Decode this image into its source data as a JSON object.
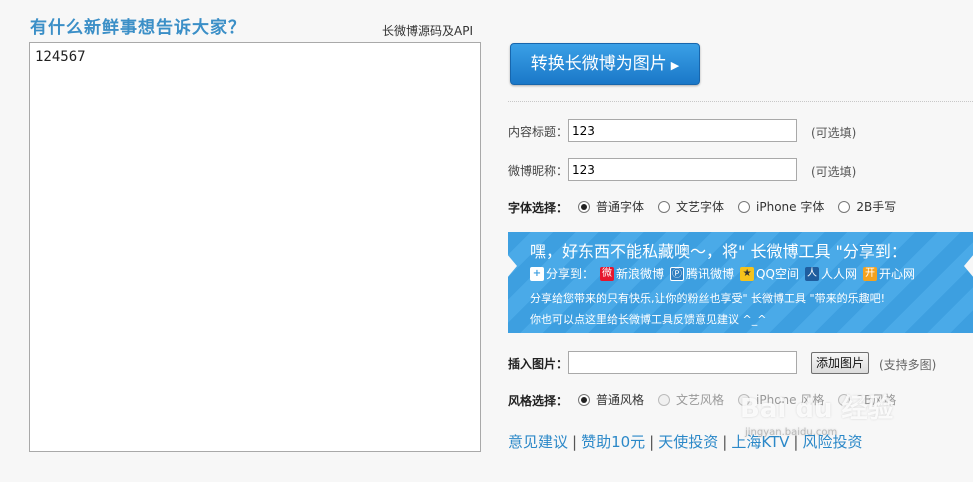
{
  "left": {
    "prompt": "有什么新鲜事想告诉大家？",
    "api_link": "长微博源码及API",
    "textarea_value": "124567"
  },
  "right": {
    "convert_button": "转换长微博为图片",
    "title_label": "内容标题：",
    "title_value": "123",
    "title_optional": "(可选填)",
    "nick_label": "微博昵称：",
    "nick_value": "123",
    "nick_optional": "(可选填)",
    "font_label": "字体选择：",
    "font_options": [
      "普通字体",
      "文艺字体",
      "iPhone 字体",
      "2B手写"
    ],
    "font_selected": "普通字体",
    "banner": {
      "title": "嘿，好东西不能私藏噢～，将\" 长微博工具 \"分享到：",
      "share_label": "分享到：",
      "share_targets": [
        "新浪微博",
        "腾讯微博",
        "QQ空间",
        "人人网",
        "开心网"
      ],
      "line1": "分享给您带来的只有快乐,让你的粉丝也享受\" 长微博工具 \"带来的乐趣吧!",
      "line2": "你也可以点这里给长微博工具反馈意见建议 ^_^"
    },
    "image_label": "插入图片：",
    "image_button": "添加图片",
    "image_multi": "(支持多图)",
    "style_label": "风格选择：",
    "style_options": [
      "普通风格",
      "文艺风格",
      "iPhone 风格",
      "2B风格"
    ],
    "style_selected": "普通风格",
    "footer_links": [
      "意见建议",
      "赞助10元",
      "天使投资",
      "上海KTV",
      "风险投资"
    ]
  },
  "watermark": {
    "text": "Bai du 经验",
    "sub": "jingyan.baidu.com"
  },
  "colors": {
    "accent": "#2b88c8",
    "button": "#1a78c8",
    "banner": "#3d9fe0"
  }
}
